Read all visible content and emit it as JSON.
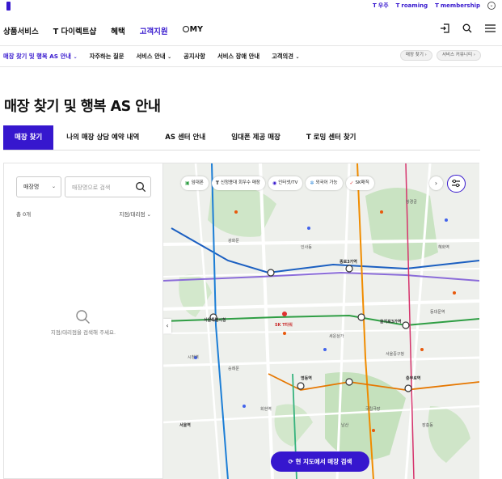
{
  "util": {
    "links": [
      {
        "prefix": "T",
        "label": "우주"
      },
      {
        "prefix": "T",
        "label": "roaming"
      },
      {
        "prefix": "T",
        "label": "membership"
      }
    ]
  },
  "gnb": {
    "menu": [
      "상품서비스",
      "T 다이렉트샵",
      "혜택",
      "고객지원",
      "MY"
    ],
    "active_index": 3
  },
  "subnav": {
    "items": [
      "매장 찾기 및 행복 AS 안내",
      "자주하는 질문",
      "서비스 안내",
      "공지사항",
      "서비스 장애 안내",
      "고객의견"
    ],
    "pills": [
      "매장 찾기",
      "서비스 커뮤니티"
    ]
  },
  "page": {
    "title": "매장 찾기 및 행복 AS 안내"
  },
  "tabs": [
    "매장 찾기",
    "나의 매장 상담 예약 내역",
    "AS 센터 안내",
    "임대폰 제공 매장",
    "T 로밍 센터 찾기"
  ],
  "search": {
    "select_value": "매장명",
    "placeholder": "매장명으로 검색",
    "count": "총 0개",
    "sort": "지점/대리점",
    "empty": "지점/대리점을 검색해 주세요."
  },
  "map": {
    "filters": [
      {
        "icon": "store-icon",
        "label": "임대폰"
      },
      {
        "icon": "t-icon",
        "label": "신청용대 회우수 매장"
      },
      {
        "icon": "tv-icon",
        "label": "인터넷/TV"
      },
      {
        "icon": "foreign-icon",
        "label": "외국어 가능"
      },
      {
        "icon": "sk-icon",
        "label": "SK매직"
      }
    ],
    "current_button": "현 지도에서 매장 검색",
    "labels": [
      "서울특별시청",
      "종로3가역",
      "을지로3가역",
      "명동역",
      "서울중구청",
      "충무로역",
      "회현역",
      "남산",
      "서울역",
      "숭례문",
      "광화문",
      "인사동",
      "창경궁",
      "혜화역",
      "동대문역",
      "시청역",
      "SK T타워",
      "세운상가",
      "국립극장",
      "장충동"
    ]
  }
}
